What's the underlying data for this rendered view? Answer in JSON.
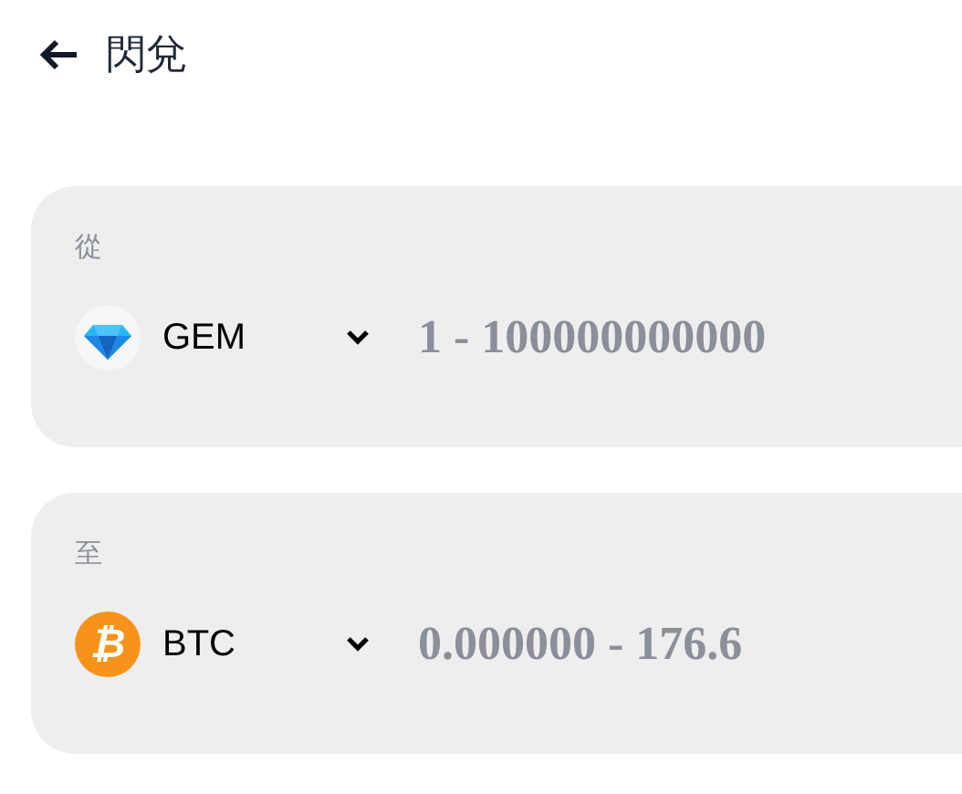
{
  "header": {
    "title": "閃兌"
  },
  "panels": [
    {
      "label": "從",
      "token": {
        "kind": "gem",
        "symbol": "GEM"
      },
      "amount": {
        "placeholder": "1 - 100000000000"
      }
    },
    {
      "label": "至",
      "token": {
        "kind": "btc",
        "symbol": "BTC",
        "glyph": "₿"
      },
      "amount": {
        "placeholder": "0.000000 - 176.6"
      }
    }
  ]
}
